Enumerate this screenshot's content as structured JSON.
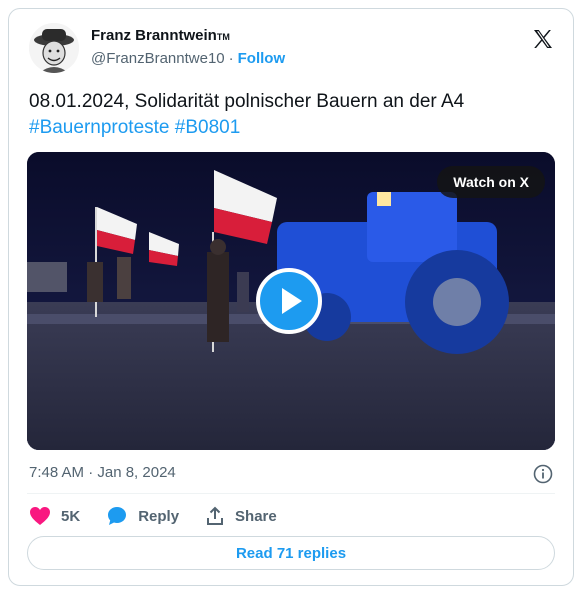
{
  "author": {
    "display_name": "Franz Branntwein",
    "trademark": "TM",
    "handle": "@FranzBranntwe10",
    "separator": "·",
    "follow_label": "Follow"
  },
  "tweet": {
    "text": "08.01.2024, Solidarität polnischer Bauern an der A4",
    "hashtags": "#Bauernproteste #B0801"
  },
  "media": {
    "watch_label": "Watch on X"
  },
  "meta": {
    "timestamp": "7:48 AM · Jan 8, 2024"
  },
  "actions": {
    "likes": "5K",
    "reply_label": "Reply",
    "share_label": "Share"
  },
  "read_replies_label": "Read 71 replies",
  "colors": {
    "accent": "#1d9bf0",
    "heart": "#f91880",
    "text_secondary": "#536471",
    "border": "#cfd9de"
  },
  "icons": [
    "avatar",
    "x-logo-icon",
    "play-icon",
    "info-icon",
    "heart-icon",
    "reply-bubble-icon",
    "share-icon"
  ]
}
